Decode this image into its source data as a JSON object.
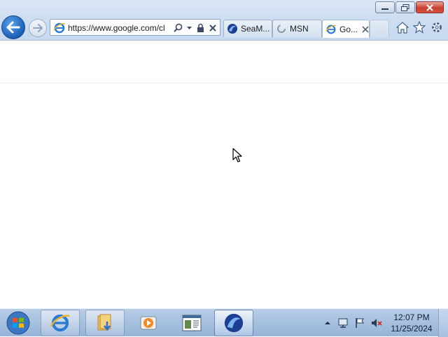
{
  "browser": {
    "address_url": "https://www.google.com/cl",
    "tabs": [
      {
        "label": "SeaM...",
        "icon": "seamonkey-icon",
        "active": false
      },
      {
        "label": "MSN",
        "icon": "loading-spinner-icon",
        "active": false
      },
      {
        "label": "Go...",
        "icon": "ie-icon",
        "active": true
      }
    ]
  },
  "taskbar": {
    "items": [
      {
        "icon": "windows-start-icon"
      },
      {
        "icon": "internet-explorer-icon"
      },
      {
        "icon": "file-explorer-icon"
      },
      {
        "icon": "media-player-icon"
      },
      {
        "icon": "document-window-icon"
      },
      {
        "icon": "seamonkey-icon"
      }
    ],
    "clock": {
      "time": "12:07 PM",
      "date": "11/25/2024"
    }
  },
  "colors": {
    "accent": "#1a5fb4",
    "taskbar": "#a6c0df",
    "close_button": "#c84031"
  }
}
